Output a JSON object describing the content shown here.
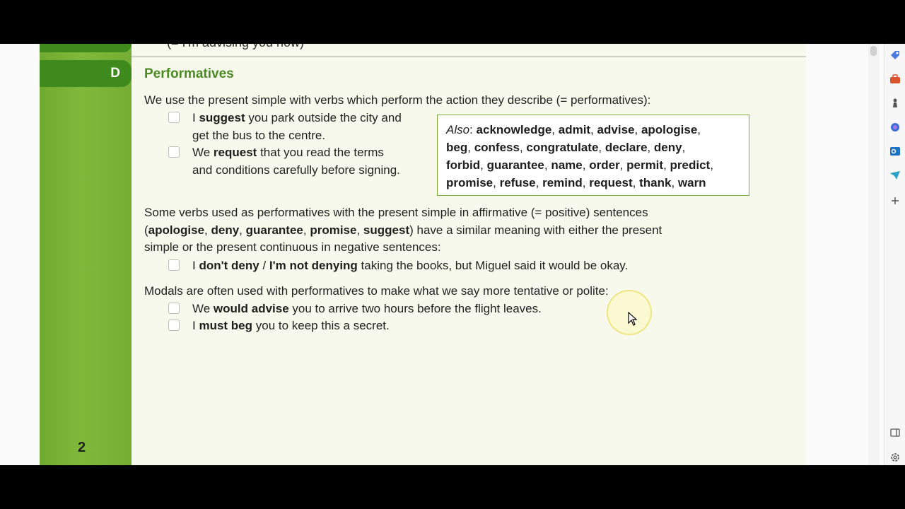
{
  "section": {
    "letter": "D",
    "heading": "Performatives",
    "page_number": "2",
    "previous_text": "(= I'm advising you now)"
  },
  "intro": "We use the present simple with verbs which perform the action they describe (= performatives):",
  "examples1": [
    {
      "lines": [
        [
          {
            "t": "I "
          },
          {
            "t": "suggest",
            "b": true
          },
          {
            "t": " you park outside the city and"
          }
        ],
        [
          {
            "t": "get the bus to the centre."
          }
        ]
      ]
    },
    {
      "lines": [
        [
          {
            "t": "We "
          },
          {
            "t": "request",
            "b": true
          },
          {
            "t": " that you read the terms"
          }
        ],
        [
          {
            "t": "and conditions carefully before signing."
          }
        ]
      ]
    }
  ],
  "also_box": {
    "lines": [
      [
        {
          "t": "Also",
          "i": true
        },
        {
          "t": ": "
        },
        {
          "t": "acknowledge",
          "b": true
        },
        {
          "t": ", "
        },
        {
          "t": "admit",
          "b": true
        },
        {
          "t": ", "
        },
        {
          "t": "advise",
          "b": true
        },
        {
          "t": ", "
        },
        {
          "t": "apologise",
          "b": true
        },
        {
          "t": ","
        }
      ],
      [
        {
          "t": "beg",
          "b": true
        },
        {
          "t": ", "
        },
        {
          "t": "confess",
          "b": true
        },
        {
          "t": ", "
        },
        {
          "t": "congratulate",
          "b": true
        },
        {
          "t": ", "
        },
        {
          "t": "declare",
          "b": true
        },
        {
          "t": ", "
        },
        {
          "t": "deny",
          "b": true
        },
        {
          "t": ","
        }
      ],
      [
        {
          "t": "forbid",
          "b": true
        },
        {
          "t": ", "
        },
        {
          "t": "guarantee",
          "b": true
        },
        {
          "t": ", "
        },
        {
          "t": "name",
          "b": true
        },
        {
          "t": ", "
        },
        {
          "t": "order",
          "b": true
        },
        {
          "t": ", "
        },
        {
          "t": "permit",
          "b": true
        },
        {
          "t": ", "
        },
        {
          "t": "predict",
          "b": true
        },
        {
          "t": ","
        }
      ],
      [
        {
          "t": "promise",
          "b": true
        },
        {
          "t": ", "
        },
        {
          "t": "refuse",
          "b": true
        },
        {
          "t": ", "
        },
        {
          "t": "remind",
          "b": true
        },
        {
          "t": ", "
        },
        {
          "t": "request",
          "b": true
        },
        {
          "t": ", "
        },
        {
          "t": "thank",
          "b": true
        },
        {
          "t": ", "
        },
        {
          "t": "warn",
          "b": true
        }
      ]
    ]
  },
  "para2": {
    "lines": [
      [
        {
          "t": "Some verbs used as performatives with the present simple in affirmative (= positive) sentences"
        }
      ],
      [
        {
          "t": "("
        },
        {
          "t": "apologise",
          "b": true
        },
        {
          "t": ", "
        },
        {
          "t": "deny",
          "b": true
        },
        {
          "t": ", "
        },
        {
          "t": "guarantee",
          "b": true
        },
        {
          "t": ", "
        },
        {
          "t": "promise",
          "b": true
        },
        {
          "t": ", "
        },
        {
          "t": "suggest",
          "b": true
        },
        {
          "t": ") have a similar meaning with either the present"
        }
      ],
      [
        {
          "t": "simple or the present continuous in negative sentences:"
        }
      ]
    ]
  },
  "example2": [
    {
      "t": "I "
    },
    {
      "t": "don't deny",
      "b": true
    },
    {
      "t": " / "
    },
    {
      "t": "I'm not denying",
      "b": true
    },
    {
      "t": " taking the books, but Miguel said it would be okay."
    }
  ],
  "para3": "Modals are often used with performatives to make what we say more tentative or polite:",
  "examples3": [
    [
      {
        "t": "We "
      },
      {
        "t": "would advise",
        "b": true
      },
      {
        "t": " you to arrive two hours before the flight leaves."
      }
    ],
    [
      {
        "t": "I "
      },
      {
        "t": "must beg",
        "b": true
      },
      {
        "t": " you to keep this a secret."
      }
    ]
  ],
  "sidebar_icons": [
    "tag-icon",
    "briefcase-icon",
    "chess-icon",
    "copilot-icon",
    "outlook-icon",
    "send-icon",
    "add-icon",
    "panel-icon",
    "settings-icon"
  ],
  "colors": {
    "accent_green": "#4a8a22",
    "bar_green": "#78b234",
    "box_border": "#7ab03a"
  }
}
